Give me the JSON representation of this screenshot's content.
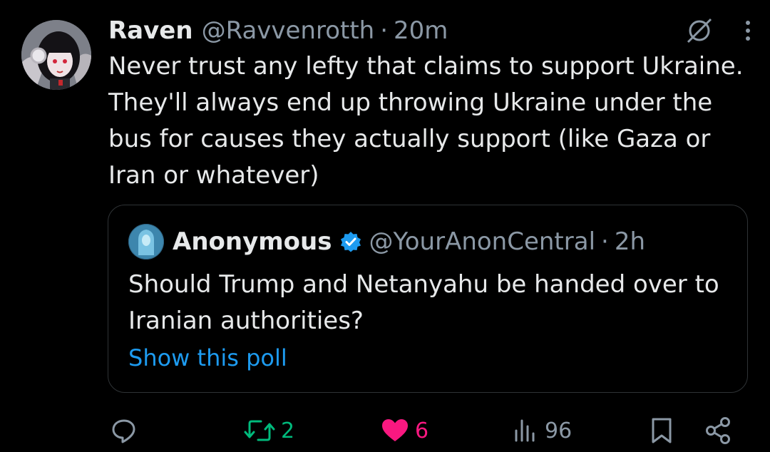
{
  "author": {
    "name": "Raven",
    "handle": "@Ravvenrotth",
    "separator": "·",
    "time": "20m"
  },
  "tweet": {
    "text": "Never trust any lefty that claims to support Ukraine. They'll always end up throwing Ukraine under the bus for causes they actually support (like Gaza or Iran or whatever)"
  },
  "quoted": {
    "name": "Anonymous",
    "handle": "@YourAnonCentral",
    "separator": "·",
    "time": "2h",
    "text": "Should Trump and Netanyahu be handed over to Iranian authorities?",
    "poll_link": "Show this poll"
  },
  "actions": {
    "reply_count": "",
    "retweet_count": "2",
    "like_count": "6",
    "views_count": "96"
  },
  "icons": {
    "top": [
      "grok-icon",
      "more-vertical-icon"
    ],
    "bottom": [
      "reply-icon",
      "retweet-icon",
      "like-icon",
      "views-icon",
      "bookmark-icon",
      "share-icon"
    ]
  },
  "colors": {
    "background": "#000000",
    "text": "#e7e9ea",
    "muted": "#8b98a5",
    "link": "#1d9bf0",
    "retweet": "#00ba7c",
    "like": "#f91880",
    "border": "#2f3336"
  }
}
